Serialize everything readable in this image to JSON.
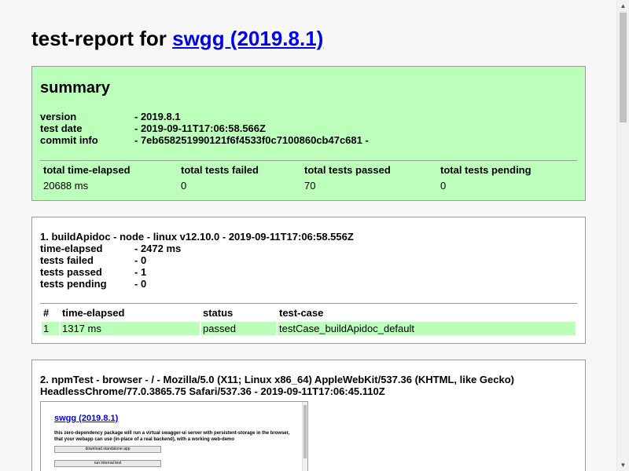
{
  "report": {
    "title_prefix": "test-report for ",
    "title_link": "swgg (2019.8.1)"
  },
  "summary": {
    "heading": "summary",
    "fields": [
      {
        "k": "version",
        "v": "- 2019.8.1"
      },
      {
        "k": "test date",
        "v": "- 2019-09-11T17:06:58.566Z"
      },
      {
        "k": "commit info",
        "v": "- 7eb658251990121f6f4533f0c7100860cb47c681 -"
      }
    ],
    "table_headers": [
      "total time-elapsed",
      "total tests failed",
      "total tests passed",
      "total tests pending"
    ],
    "table_values": [
      "20688 ms",
      "0",
      "70",
      "0"
    ]
  },
  "test1": {
    "title": "1. buildApidoc - node - linux v12.10.0 - 2019-09-11T17:06:58.556Z",
    "fields": [
      {
        "k": "time-elapsed",
        "v": "- 2472 ms"
      },
      {
        "k": "tests failed",
        "v": "- 0"
      },
      {
        "k": "tests passed",
        "v": "- 1"
      },
      {
        "k": "tests pending",
        "v": "- 0"
      }
    ],
    "headers": [
      "#",
      "time-elapsed",
      "status",
      "test-case"
    ],
    "row": [
      "1",
      "1317 ms",
      "passed",
      "testCase_buildApidoc_default"
    ]
  },
  "test2": {
    "title_line1": "2. npmTest - browser - / - Mozilla/5.0 (X11; Linux x86_64) AppleWebKit/537.36 (KHTML, like Gecko)",
    "title_line2": "HeadlessChrome/77.0.3865.75 Safari/537.36 - 2019-09-11T17:06:45.110Z"
  },
  "screenshot": {
    "title": "swgg (2019.8.1)",
    "desc": "this zero-dependency package will run a virtual swagger-ui server with persistent-storage in the browser, that your webapp can use (in-place of a real backend), with a working web-demo",
    "btn1": "download standalone app",
    "btn2": "run internal test"
  },
  "colors": {
    "pass_green": "#bbffbb",
    "link_blue": "#0000ee"
  }
}
